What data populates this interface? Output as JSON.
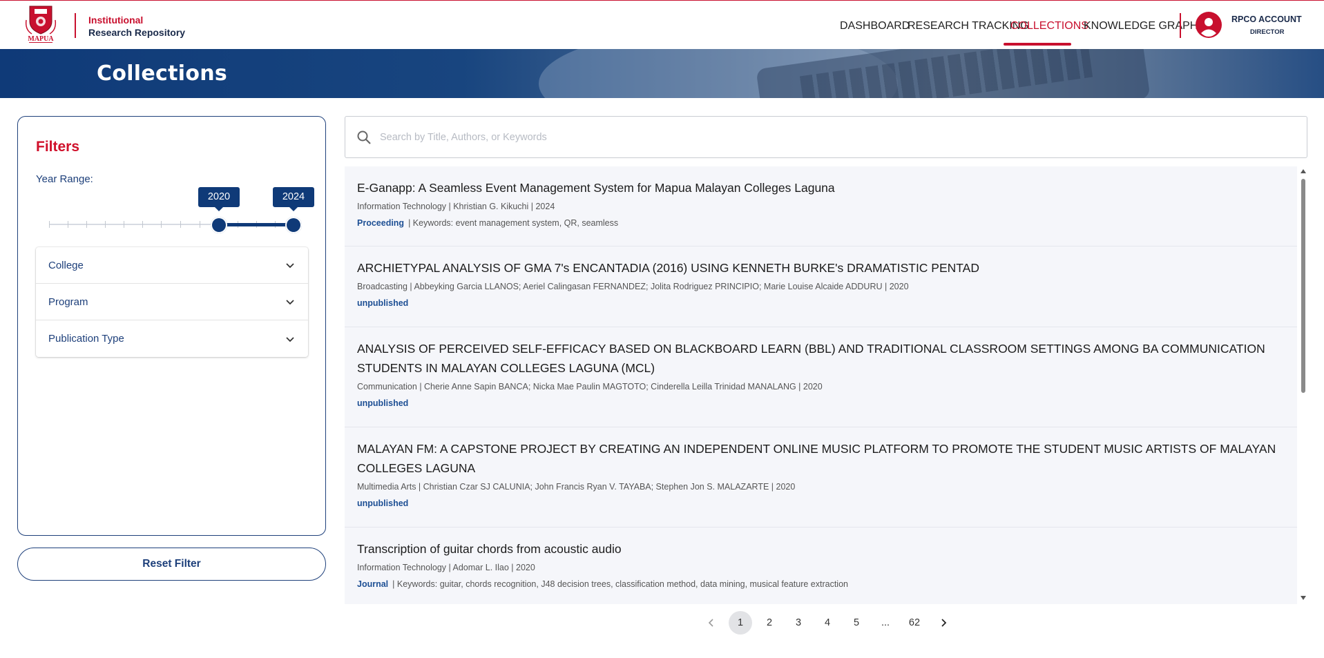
{
  "header": {
    "brand_line1": "Institutional",
    "brand_line2": "Research Repository",
    "logo_text": "MAPUA",
    "nav": [
      {
        "label": "DASHBOARD"
      },
      {
        "label": "RESEARCH TRACKING"
      },
      {
        "label": "COLLECTIONS",
        "active": true
      },
      {
        "label": "KNOWLEDGE GRAPH"
      }
    ],
    "account_name": "RPCO ACCOUNT",
    "account_role": "DIRECTOR"
  },
  "banner": {
    "title": "Collections"
  },
  "filters": {
    "title": "Filters",
    "year_label": "Year Range:",
    "year_from": "2020",
    "year_to": "2024",
    "sections": [
      "College",
      "Program",
      "Publication Type"
    ],
    "reset_label": "Reset Filter"
  },
  "search": {
    "placeholder": "Search by Title, Authors, or Keywords",
    "value": ""
  },
  "results": [
    {
      "title": "E-Ganapp: A Seamless Event Management System for Mapua Malayan Colleges Laguna",
      "meta": "Information Technology | Khristian G. Kikuchi | 2024",
      "type": "Proceeding",
      "keywords": "| Keywords: event management system, QR, seamless"
    },
    {
      "title": "ARCHIETYPAL ANALYSIS OF GMA 7's ENCANTADIA (2016) USING KENNETH BURKE's DRAMATISTIC PENTAD",
      "meta": "Broadcasting | Abbeyking Garcia LLANOS; Aeriel Calingasan FERNANDEZ; Jolita Rodriguez PRINCIPIO; Marie Louise Alcaide ADDURU | 2020",
      "type": "unpublished",
      "keywords": ""
    },
    {
      "title": "ANALYSIS OF PERCEIVED SELF-EFFICACY BASED ON BLACKBOARD LEARN (BBL) AND TRADITIONAL CLASSROOM SETTINGS AMONG BA COMMUNICATION STUDENTS IN MALAYAN COLLEGES LAGUNA (MCL)",
      "meta": "Communication | Cherie Anne Sapin BANCA; Nicka Mae Paulin MAGTOTO; Cinderella Leilla Trinidad MANALANG | 2020",
      "type": "unpublished",
      "keywords": ""
    },
    {
      "title": "MALAYAN FM: A CAPSTONE PROJECT BY CREATING AN INDEPENDENT ONLINE MUSIC PLATFORM TO PROMOTE THE STUDENT MUSIC ARTISTS OF MALAYAN COLLEGES LAGUNA",
      "meta": "Multimedia Arts | Christian Czar SJ CALUNIA; John Francis Ryan V. TAYABA; Stephen Jon S. MALAZARTE | 2020",
      "type": "unpublished",
      "keywords": ""
    },
    {
      "title": "Transcription of guitar chords from acoustic audio",
      "meta": "Information Technology | Adomar L. Ilao | 2020",
      "type": "Journal",
      "keywords": "| Keywords: guitar, chords recognition, J48 decision trees, classification method, data mining, musical feature extraction"
    }
  ],
  "pagination": {
    "pages": [
      "1",
      "2",
      "3",
      "4",
      "5",
      "...",
      "62"
    ],
    "current": "1"
  },
  "colors": {
    "brand_red": "#c8102e",
    "brand_navy": "#0f3a78",
    "link_blue": "#1d4f94"
  }
}
